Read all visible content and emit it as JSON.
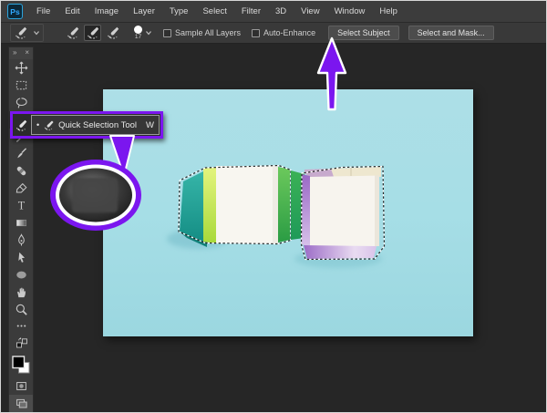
{
  "app": {
    "logo_text": "Ps"
  },
  "menu": {
    "items": [
      "File",
      "Edit",
      "Image",
      "Layer",
      "Type",
      "Select",
      "Filter",
      "3D",
      "View",
      "Window",
      "Help"
    ]
  },
  "options": {
    "brush_size": "17",
    "sample_all_layers_label": "Sample All Layers",
    "auto_enhance_label": "Auto-Enhance",
    "select_subject_label": "Select Subject",
    "select_and_mask_label": "Select and Mask..."
  },
  "toolbar": {
    "collapse_icon_glyph": "»",
    "close_icon_glyph": "×",
    "type_tool_glyph": "T",
    "tools": [
      "move",
      "rectangular-marquee",
      "lasso",
      "quick-selection",
      "eyedropper",
      "brush",
      "spot-healing-brush",
      "eraser",
      "type",
      "gradient",
      "pen",
      "direct-selection",
      "ellipse-shape",
      "hand",
      "zoom",
      "edit-toolbar",
      "swap-colors",
      "foreground-background-colors",
      "quick-mask-mode",
      "screen-mode"
    ]
  },
  "callout": {
    "bullet": "•",
    "label": "Quick Selection Tool",
    "shortcut": "W"
  },
  "colors": {
    "accent_purple": "#7b16ef",
    "canvas_cyan": "#a6dee6",
    "ui_dark": "#3b3b3b",
    "workspace": "#262626"
  }
}
